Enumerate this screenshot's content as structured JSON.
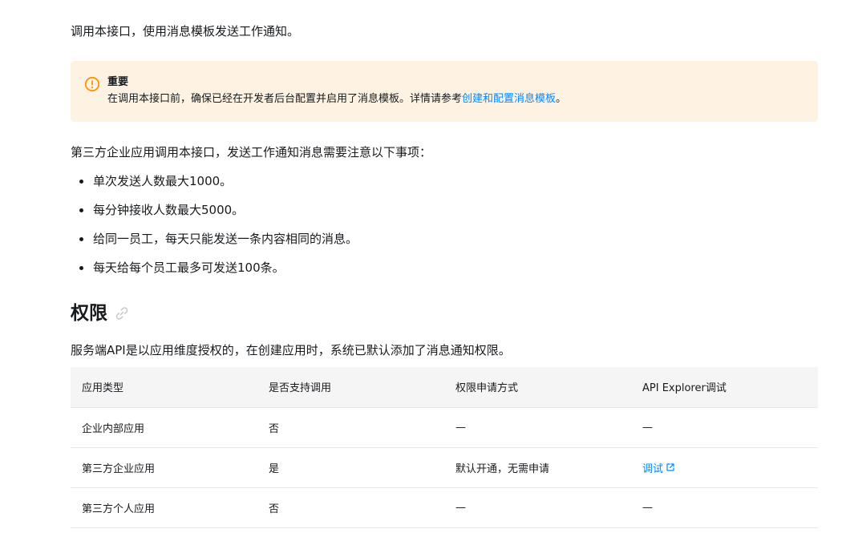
{
  "intro": "调用本接口，使用消息模板发送工作通知。",
  "notice": {
    "title": "重要",
    "body": "在调用本接口前，确保已经在开发者后台配置并启用了消息模板。详情请参考",
    "link": "创建和配置消息模板",
    "suffix": "。",
    "icon": "warning-circle-icon",
    "accent_color": "#ff9200",
    "background": "#fef2e3"
  },
  "notes_intro": "第三方企业应用调用本接口，发送工作通知消息需要注意以下事项：",
  "notes": [
    "单次发送人数最大1000。",
    "每分钟接收人数最大5000。",
    "给同一员工，每天只能发送一条内容相同的消息。",
    "每天给每个员工最多可发送100条。"
  ],
  "permission": {
    "heading": "权限",
    "heading_icon": "link-icon",
    "description": "服务端API是以应用维度授权的，在创建应用时，系统已默认添加了消息通知权限。",
    "table": {
      "headers": [
        "应用类型",
        "是否支持调用",
        "权限申请方式",
        "API Explorer调试"
      ],
      "rows": [
        [
          "企业内部应用",
          "否",
          "—",
          "—"
        ],
        [
          "第三方企业应用",
          "是",
          "默认开通，无需申请",
          "调试"
        ],
        [
          "第三方个人应用",
          "否",
          "—",
          "—"
        ]
      ]
    }
  },
  "link_color": "#0089ff"
}
